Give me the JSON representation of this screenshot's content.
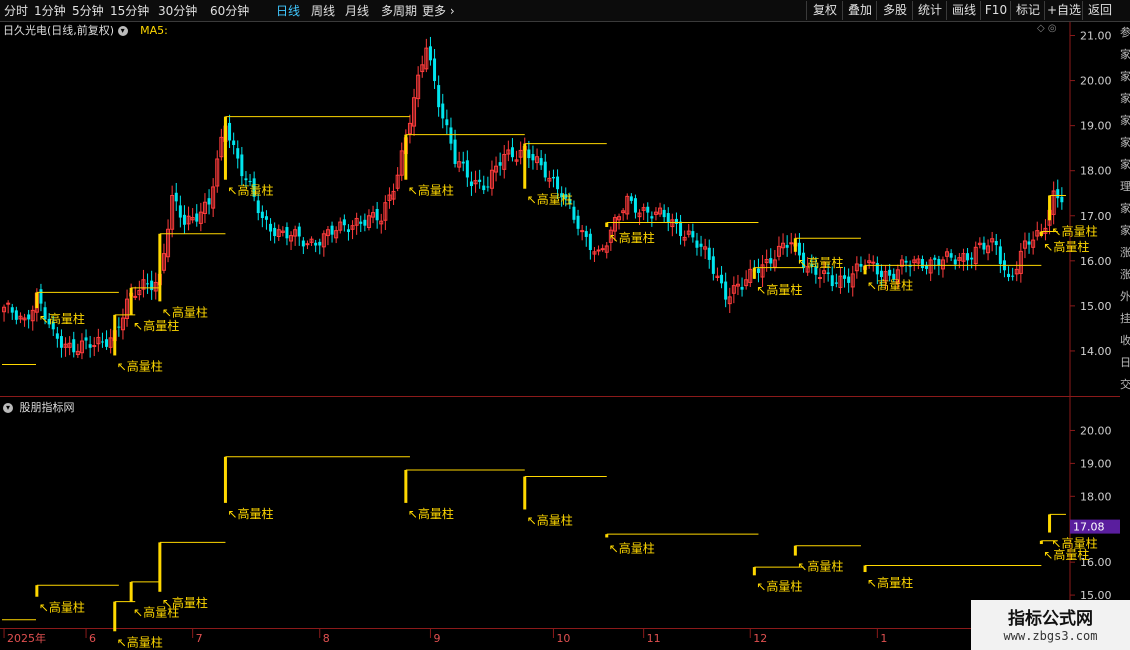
{
  "periods": [
    "分时",
    "1分钟",
    "5分钟",
    "15分钟",
    "30分钟",
    "60分钟",
    "日线",
    "周线",
    "月线",
    "多周期",
    "更多"
  ],
  "active_period": "日线",
  "more_arrow": "›",
  "tools": [
    "复权",
    "叠加",
    "多股",
    "统计",
    "画线",
    "F10",
    "标记",
    "+自选",
    "返回"
  ],
  "main_title": "日久光电(日线,前复权)",
  "ma_label": "MA5:",
  "sub_title": "股朋指标网",
  "corner_icons": "◇ ◎",
  "side_text": [
    "参",
    "家",
    "家",
    "家",
    "家",
    "家",
    "家",
    "理",
    "家",
    "家",
    "涨",
    "涨",
    "外",
    "挂",
    "收",
    "日",
    "交"
  ],
  "watermark": {
    "name": "指标公式网",
    "url": "www.zbgs3.com"
  },
  "colors": {
    "up": "#ff3c3c",
    "down": "#00e5ee",
    "signal": "#ffd800",
    "price_tag": "#5a1e9e"
  },
  "chart_data": {
    "type": "candlestick",
    "price_axis": [
      21.0,
      20.0,
      19.0,
      18.0,
      17.0,
      16.0,
      15.0,
      14.0
    ],
    "sub_axis": [
      20.0,
      19.0,
      18.0,
      17.0,
      16.0,
      15.0
    ],
    "price_range": [
      13.0,
      21.3
    ],
    "sub_range": [
      14.0,
      20.5
    ],
    "x_labels": [
      {
        "label": "2025年",
        "day": 0
      },
      {
        "label": "6",
        "day": 20
      },
      {
        "label": "7",
        "day": 46
      },
      {
        "label": "8",
        "day": 77
      },
      {
        "label": "9",
        "day": 104
      },
      {
        "label": "10",
        "day": 134
      },
      {
        "label": "11",
        "day": 156
      },
      {
        "label": "12",
        "day": 182
      },
      {
        "label": "1",
        "day": 213
      }
    ],
    "last_price_tag": "17.08",
    "last_price": 17.08,
    "signal_label": "↖高量柱",
    "signals": [
      {
        "day": 8,
        "high": 15.3,
        "low": 14.95,
        "len": 20
      },
      {
        "day": 27,
        "high": 14.8,
        "low": 13.9,
        "len": 5
      },
      {
        "day": 31,
        "high": 15.4,
        "low": 14.8,
        "len": 7
      },
      {
        "day": 38,
        "high": 16.6,
        "low": 15.1,
        "len": 16
      },
      {
        "day": 54,
        "high": 19.2,
        "low": 17.8,
        "len": 45
      },
      {
        "day": 98,
        "high": 18.8,
        "low": 17.8,
        "len": 29
      },
      {
        "day": 127,
        "high": 18.6,
        "low": 17.6,
        "len": 20
      },
      {
        "day": 147,
        "high": 16.85,
        "low": 16.75,
        "len": 37
      },
      {
        "day": 183,
        "high": 15.85,
        "low": 15.6,
        "len": 12
      },
      {
        "day": 193,
        "high": 16.5,
        "low": 16.2,
        "len": 16
      },
      {
        "day": 210,
        "high": 15.9,
        "low": 15.7,
        "len": 43
      },
      {
        "day": 253,
        "high": 16.65,
        "low": 16.55,
        "len": 4
      },
      {
        "day": 255,
        "high": 17.45,
        "low": 16.9,
        "len": 4
      }
    ],
    "closes_anchor": [
      [
        0,
        14.9
      ],
      [
        5,
        14.7
      ],
      [
        8,
        15.2
      ],
      [
        12,
        14.3
      ],
      [
        17,
        14.1
      ],
      [
        22,
        14.1
      ],
      [
        27,
        14.4
      ],
      [
        30,
        15.0
      ],
      [
        34,
        15.5
      ],
      [
        38,
        15.6
      ],
      [
        41,
        17.3
      ],
      [
        44,
        16.9
      ],
      [
        50,
        17.2
      ],
      [
        54,
        19.1
      ],
      [
        58,
        18.0
      ],
      [
        63,
        16.9
      ],
      [
        68,
        16.6
      ],
      [
        74,
        16.4
      ],
      [
        80,
        16.6
      ],
      [
        86,
        16.9
      ],
      [
        92,
        16.9
      ],
      [
        96,
        18.0
      ],
      [
        100,
        19.5
      ],
      [
        103,
        20.8
      ],
      [
        106,
        19.6
      ],
      [
        110,
        18.2
      ],
      [
        114,
        17.8
      ],
      [
        118,
        17.7
      ],
      [
        122,
        18.3
      ],
      [
        127,
        18.5
      ],
      [
        131,
        18.0
      ],
      [
        136,
        17.6
      ],
      [
        141,
        16.5
      ],
      [
        145,
        16.2
      ],
      [
        149,
        16.8
      ],
      [
        152,
        17.3
      ],
      [
        157,
        17.1
      ],
      [
        162,
        16.9
      ],
      [
        167,
        16.6
      ],
      [
        172,
        16.0
      ],
      [
        176,
        15.3
      ],
      [
        180,
        15.4
      ],
      [
        184,
        15.9
      ],
      [
        188,
        16.1
      ],
      [
        192,
        16.4
      ],
      [
        197,
        15.8
      ],
      [
        202,
        15.5
      ],
      [
        206,
        15.7
      ],
      [
        210,
        15.9
      ],
      [
        216,
        15.7
      ],
      [
        220,
        15.9
      ],
      [
        226,
        16.0
      ],
      [
        232,
        16.0
      ],
      [
        238,
        16.3
      ],
      [
        242,
        16.3
      ],
      [
        245,
        15.6
      ],
      [
        249,
        16.3
      ],
      [
        253,
        16.6
      ],
      [
        256,
        17.5
      ],
      [
        258,
        17.4
      ]
    ]
  }
}
